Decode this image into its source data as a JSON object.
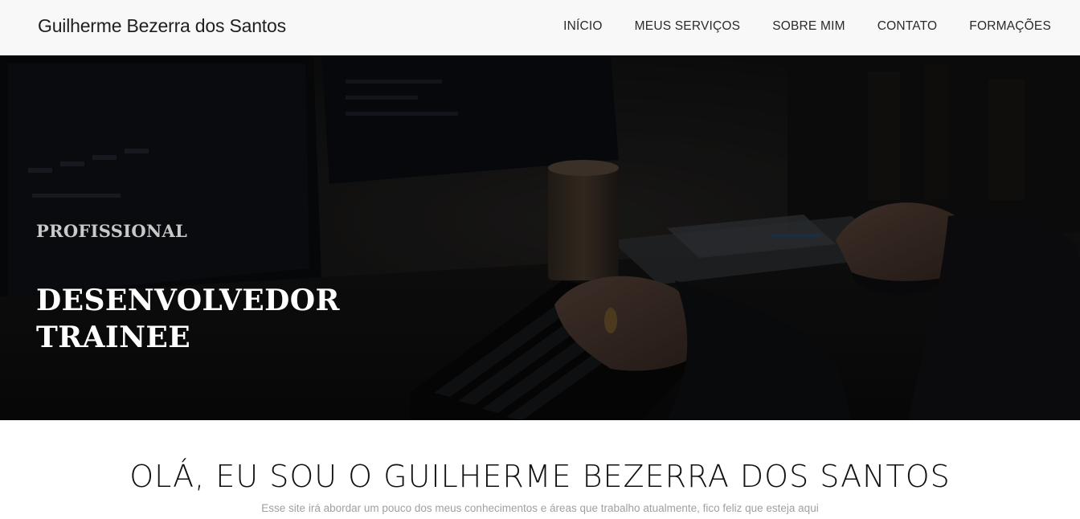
{
  "navbar": {
    "brand": "Guilherme Bezerra dos Santos",
    "links": [
      {
        "label": "INÍCIO"
      },
      {
        "label": "MEUS SERVIÇOS"
      },
      {
        "label": "SOBRE MIM"
      },
      {
        "label": "CONTATO"
      },
      {
        "label": "FORMAÇÕES"
      }
    ]
  },
  "hero": {
    "eyebrow": "PROFISSIONAL",
    "title_line1": "DESENVOLVEDOR",
    "title_line2": "TRAINEE",
    "background_image": "dark photo of a person typing on a keyboard at a desk with monitors and a coffee cup"
  },
  "intro": {
    "heading": "OLÁ, EU SOU O GUILHERME BEZERRA DOS SANTOS",
    "subtitle": "Esse site irá abordar um pouco dos meus conhecimentos e áreas que trabalho atualmente, fico feliz que esteja aqui"
  },
  "colors": {
    "navbar_bg": "#f8f8f8",
    "hero_text": "#ffffff",
    "eyebrow_text": "#c9c9c9",
    "subtitle_text": "#a0a0a0"
  }
}
